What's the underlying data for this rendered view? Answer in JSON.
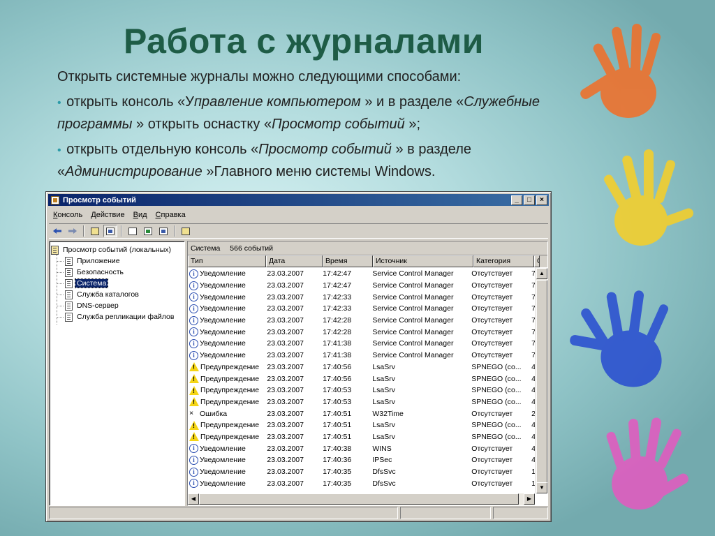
{
  "slide": {
    "title": "Работа с журналами",
    "intro": "Открыть системные журналы можно следующими способами:",
    "bullet1": {
      "text_a": "открыть консоль «У",
      "italic_a": "правление компьютером",
      "text_b": " » и в разделе «",
      "italic_b": "Служебные программы",
      "text_c": " » открыть оснастку «",
      "italic_c": "Просмотр событий",
      "text_d": " »;"
    },
    "bullet2": {
      "text_a": "открыть отдельную консоль «",
      "italic_a": "Просмотр событий",
      "text_b": " » в разделе «",
      "italic_b": "Администрирование",
      "text_c": " »Главного меню системы Windows."
    },
    "bullet_glyph": "•"
  },
  "window": {
    "title": "Просмотр событий",
    "controls": {
      "minimize": "_",
      "maximize": "□",
      "close": "×"
    },
    "menu": [
      "Консоль",
      "Действие",
      "Вид",
      "Справка"
    ],
    "toolbar_icons": [
      "back-arrow-icon",
      "forward-arrow-icon",
      "up-folder-icon",
      "show-tree-icon",
      "properties-icon",
      "refresh-icon",
      "export-icon",
      "help-icon"
    ],
    "tree": {
      "root": "Просмотр событий (локальных)",
      "items": [
        "Приложение",
        "Безопасность",
        "Система",
        "Служба каталогов",
        "DNS-сервер",
        "Служба репликации файлов"
      ],
      "selected_index": 2
    },
    "list": {
      "log_name": "Система",
      "count_label": "566 событий",
      "columns": [
        "Тип",
        "Дата",
        "Время",
        "Источник",
        "Категория",
        "С"
      ],
      "rows": [
        {
          "kind": "info",
          "type": "Уведомление",
          "date": "23.03.2007",
          "time": "17:42:47",
          "source": "Service Control Manager",
          "category": "Отсутствует",
          "event": "7"
        },
        {
          "kind": "info",
          "type": "Уведомление",
          "date": "23.03.2007",
          "time": "17:42:47",
          "source": "Service Control Manager",
          "category": "Отсутствует",
          "event": "7"
        },
        {
          "kind": "info",
          "type": "Уведомление",
          "date": "23.03.2007",
          "time": "17:42:33",
          "source": "Service Control Manager",
          "category": "Отсутствует",
          "event": "7"
        },
        {
          "kind": "info",
          "type": "Уведомление",
          "date": "23.03.2007",
          "time": "17:42:33",
          "source": "Service Control Manager",
          "category": "Отсутствует",
          "event": "7"
        },
        {
          "kind": "info",
          "type": "Уведомление",
          "date": "23.03.2007",
          "time": "17:42:28",
          "source": "Service Control Manager",
          "category": "Отсутствует",
          "event": "7"
        },
        {
          "kind": "info",
          "type": "Уведомление",
          "date": "23.03.2007",
          "time": "17:42:28",
          "source": "Service Control Manager",
          "category": "Отсутствует",
          "event": "7"
        },
        {
          "kind": "info",
          "type": "Уведомление",
          "date": "23.03.2007",
          "time": "17:41:38",
          "source": "Service Control Manager",
          "category": "Отсутствует",
          "event": "7"
        },
        {
          "kind": "info",
          "type": "Уведомление",
          "date": "23.03.2007",
          "time": "17:41:38",
          "source": "Service Control Manager",
          "category": "Отсутствует",
          "event": "7"
        },
        {
          "kind": "warn",
          "type": "Предупреждение",
          "date": "23.03.2007",
          "time": "17:40:56",
          "source": "LsaSrv",
          "category": "SPNEGO (со...",
          "event": "4"
        },
        {
          "kind": "warn",
          "type": "Предупреждение",
          "date": "23.03.2007",
          "time": "17:40:56",
          "source": "LsaSrv",
          "category": "SPNEGO (со...",
          "event": "4"
        },
        {
          "kind": "warn",
          "type": "Предупреждение",
          "date": "23.03.2007",
          "time": "17:40:53",
          "source": "LsaSrv",
          "category": "SPNEGO (со...",
          "event": "4"
        },
        {
          "kind": "warn",
          "type": "Предупреждение",
          "date": "23.03.2007",
          "time": "17:40:53",
          "source": "LsaSrv",
          "category": "SPNEGO (со...",
          "event": "4"
        },
        {
          "kind": "error",
          "type": "Ошибка",
          "date": "23.03.2007",
          "time": "17:40:51",
          "source": "W32Time",
          "category": "Отсутствует",
          "event": "2"
        },
        {
          "kind": "warn",
          "type": "Предупреждение",
          "date": "23.03.2007",
          "time": "17:40:51",
          "source": "LsaSrv",
          "category": "SPNEGO (со...",
          "event": "4"
        },
        {
          "kind": "warn",
          "type": "Предупреждение",
          "date": "23.03.2007",
          "time": "17:40:51",
          "source": "LsaSrv",
          "category": "SPNEGO (со...",
          "event": "4"
        },
        {
          "kind": "info",
          "type": "Уведомление",
          "date": "23.03.2007",
          "time": "17:40:38",
          "source": "WINS",
          "category": "Отсутствует",
          "event": "4"
        },
        {
          "kind": "info",
          "type": "Уведомление",
          "date": "23.03.2007",
          "time": "17:40:36",
          "source": "IPSec",
          "category": "Отсутствует",
          "event": "4"
        },
        {
          "kind": "info",
          "type": "Уведомление",
          "date": "23.03.2007",
          "time": "17:40:35",
          "source": "DfsSvc",
          "category": "Отсутствует",
          "event": "1"
        },
        {
          "kind": "info",
          "type": "Уведомление",
          "date": "23.03.2007",
          "time": "17:40:35",
          "source": "DfsSvc",
          "category": "Отсутствует",
          "event": "1"
        }
      ]
    }
  },
  "decor": {
    "hand_colors": [
      "#f0702a",
      "#f5cf2a",
      "#2a4fd0",
      "#e25bc0"
    ]
  }
}
